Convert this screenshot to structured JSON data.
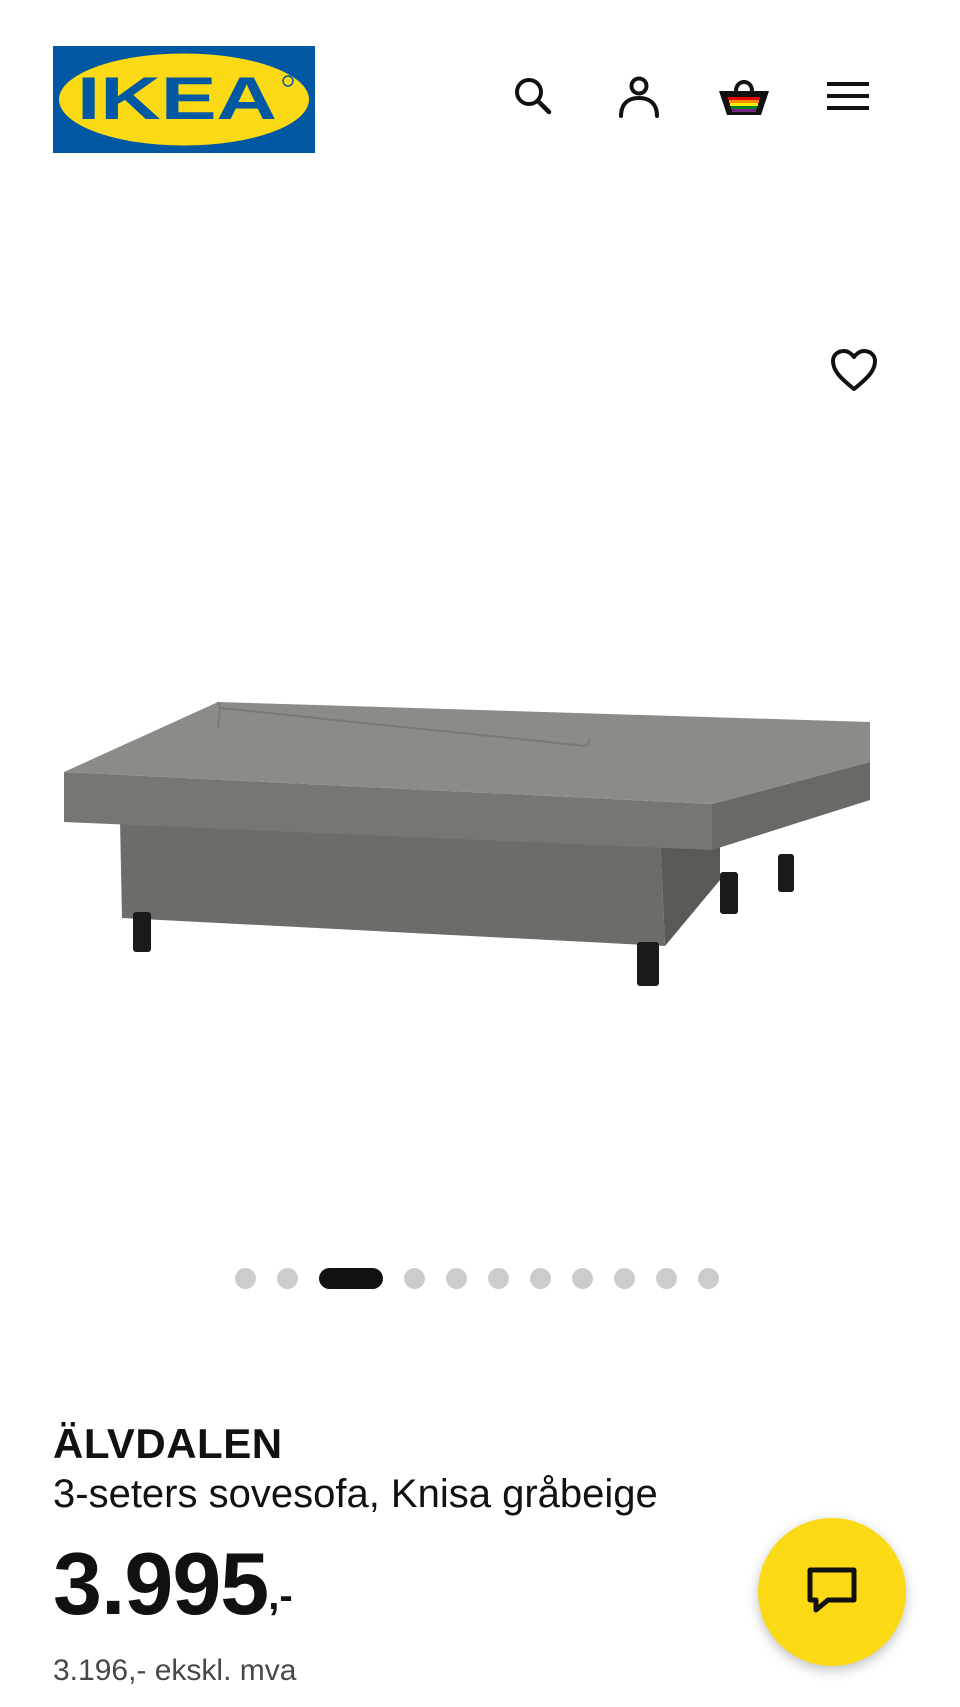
{
  "brand": {
    "logo_text": "IKEA",
    "colors": {
      "blue": "#0058a3",
      "yellow": "#fbd914"
    }
  },
  "header": {
    "icons": [
      "search-icon",
      "account-icon",
      "shopping-basket-icon",
      "menu-icon"
    ]
  },
  "gallery": {
    "image_count": 11,
    "active_index": 2,
    "favourite_icon": "heart-icon"
  },
  "product": {
    "name": "ÄLVDALEN",
    "description": "3-seters sovesofa, Knisa gråbeige",
    "price_main": "3.995",
    "price_suffix": ",-",
    "price_ex_vat": "3.196,- ekskl. mva"
  },
  "chat": {
    "icon": "chat-icon"
  }
}
